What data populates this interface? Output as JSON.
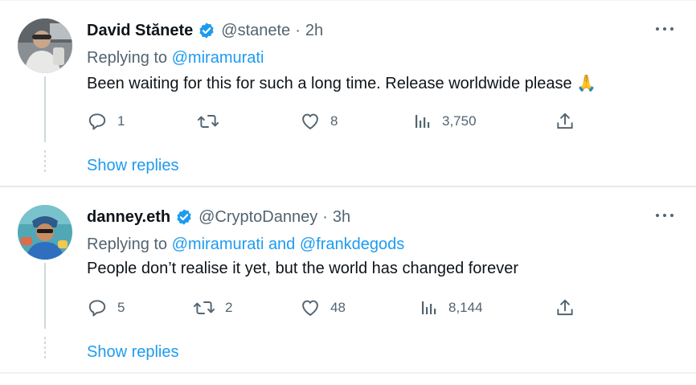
{
  "colors": {
    "link": "#1d9bf0",
    "secondary_text": "#536471",
    "primary_text": "#0f1419",
    "verified_badge": "#1d9bf0",
    "divider": "#eff3f4"
  },
  "tweets": [
    {
      "name": "David Stănete",
      "handle": "@stanete",
      "separator": "·",
      "time": "2h",
      "replying_prefix": "Replying to",
      "replying_to": "@miramurati",
      "text": "Been waiting for this for such a long time. Release worldwide please",
      "emoji": "🙏",
      "replies": "1",
      "retweets": "",
      "likes": "8",
      "views": "3,750",
      "show_replies": "Show replies",
      "icons": [
        "reply-icon",
        "retweet-icon",
        "like-icon",
        "views-icon",
        "share-icon",
        "more-icon",
        "verified-icon"
      ]
    },
    {
      "name": "danney.eth",
      "handle": "@CryptoDanney",
      "separator": "·",
      "time": "3h",
      "replying_prefix": "Replying to",
      "replying_to": "@miramurati and @frankdegods",
      "text": "People don’t realise it yet, but the world has changed forever",
      "replies": "5",
      "retweets": "2",
      "likes": "48",
      "views": "8,144",
      "show_replies": "Show replies",
      "icons": [
        "reply-icon",
        "retweet-icon",
        "like-icon",
        "views-icon",
        "share-icon",
        "more-icon",
        "verified-icon"
      ]
    }
  ]
}
